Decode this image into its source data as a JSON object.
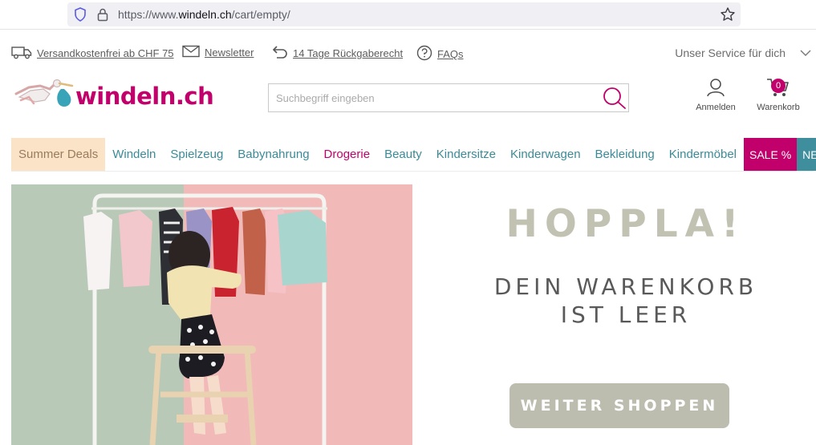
{
  "browser": {
    "url_prefix": "https://www.",
    "url_host": "windeln.ch",
    "url_path": "/cart/empty/"
  },
  "topbar": {
    "links": [
      {
        "label": "Versandkostenfrei ab CHF 75",
        "icon": "truck-icon"
      },
      {
        "label": "Newsletter",
        "icon": "envelope-icon"
      },
      {
        "label": "14 Tage Rückgaberecht",
        "icon": "return-arrow-icon"
      },
      {
        "label": "FAQs",
        "icon": "question-icon"
      }
    ],
    "service_label": "Unser Service für dich"
  },
  "header": {
    "logo_text": "windeln.ch",
    "search_placeholder": "Suchbegriff eingeben",
    "account_label": "Anmelden",
    "cart_label": "Warenkorb",
    "cart_count": "0"
  },
  "nav": {
    "items": [
      "Summer Deals",
      "Windeln",
      "Spielzeug",
      "Babynahrung",
      "Drogerie",
      "Beauty",
      "Kindersitze",
      "Kinderwagen",
      "Bekleidung",
      "Kindermöbel",
      "SALE %",
      "NEU"
    ]
  },
  "hero": {
    "title": "HOPPLA!",
    "subtitle_line1": "DEIN WARENKORB",
    "subtitle_line2": "IST LEER",
    "cta_label": "WEITER SHOPPEN"
  },
  "colors": {
    "brand": "#c2006b",
    "nav_text": "#3a8b99",
    "deals_bg": "#fbe3c7",
    "neu_bg": "#3e8e9e",
    "cta_bg": "#bcbcaf"
  }
}
